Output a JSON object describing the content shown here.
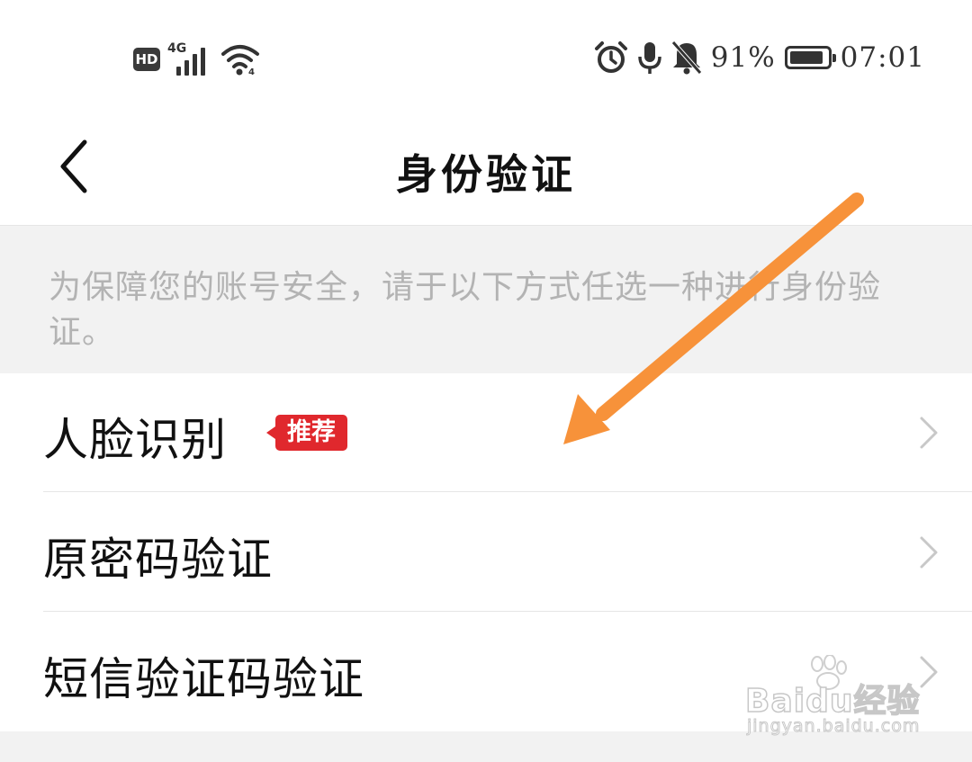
{
  "status_bar": {
    "hd_label": "HD",
    "network_label": "4G",
    "battery_percent": "91%",
    "battery_level": 0.91,
    "time": "07:01",
    "icons": [
      "hd-icon",
      "signal-icon",
      "wifi-icon",
      "alarm-icon",
      "microphone-icon",
      "bell-muted-icon",
      "battery-icon"
    ]
  },
  "header": {
    "title": "身份验证",
    "back_icon": "chevron-left-icon"
  },
  "notice": {
    "text": "为保障您的账号安全，请于以下方式任选一种进行身份验证。"
  },
  "options": [
    {
      "label": "人脸识别",
      "tag": "推荐"
    },
    {
      "label": "原密码验证"
    },
    {
      "label": "短信验证码验证"
    }
  ],
  "annotation": {
    "arrow_color": "#f7923a"
  },
  "watermark": {
    "brand": "Baidu经验",
    "url": "jingyan.baidu.com"
  },
  "colors": {
    "tag_bg": "#e0282d",
    "notice_bg": "#f2f2f2",
    "notice_text": "#b3b3b3"
  }
}
